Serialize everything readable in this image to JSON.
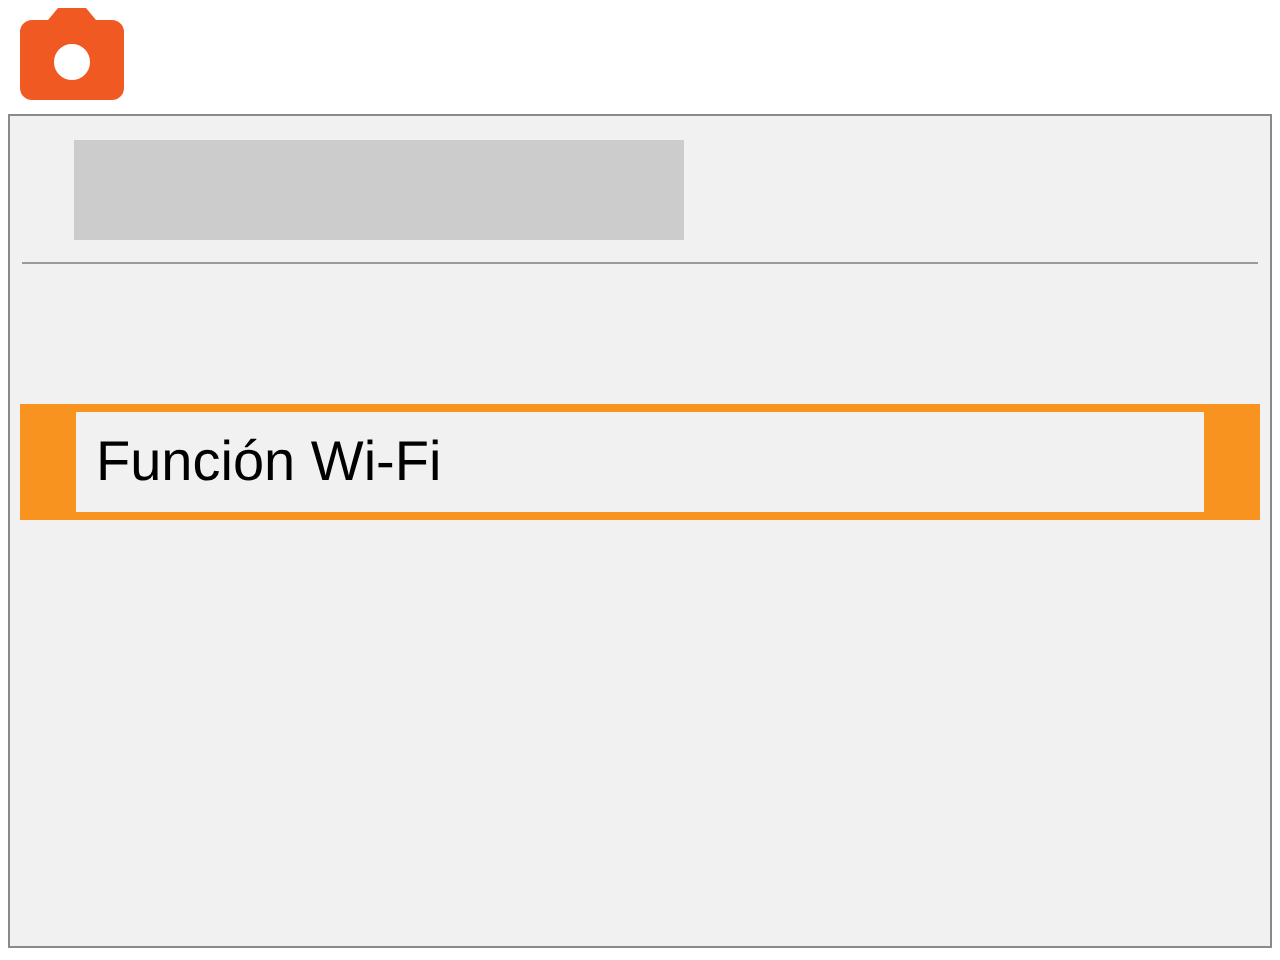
{
  "menu": {
    "items": [
      {
        "label": "Función Wi-Fi",
        "selected": true
      }
    ]
  }
}
